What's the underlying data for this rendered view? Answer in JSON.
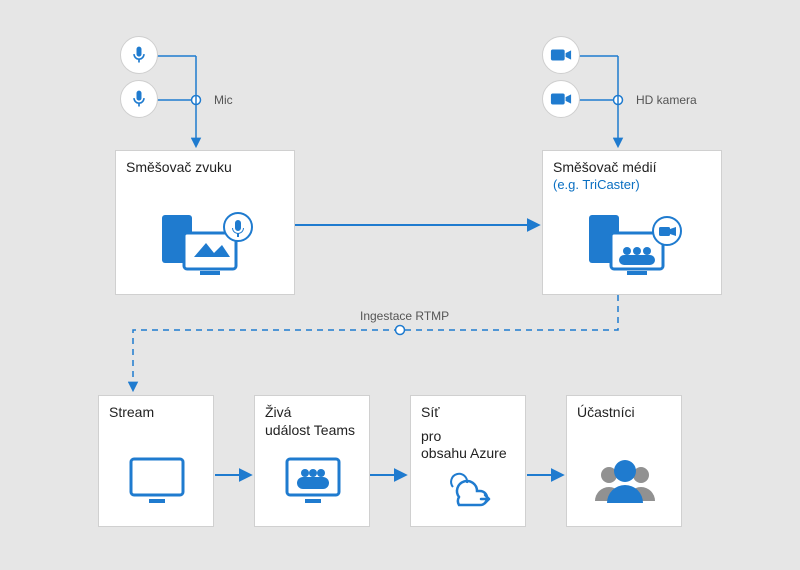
{
  "diagram": {
    "nodes": {
      "mic_label": "Mic",
      "camera_label": "HD kamera",
      "audio_mixer": {
        "title": "Směšovač zvuku"
      },
      "media_mixer": {
        "title": "Směšovač médií",
        "subtitle": "(e.g. TriCaster)"
      },
      "rtmp_label": "Ingestace RTMP",
      "stream": {
        "title": "Stream"
      },
      "teams_live": {
        "title_line1": "Živá",
        "title_line2": "událost Teams"
      },
      "azure_cdn": {
        "title_line1": "Síť",
        "title_line2": "pro",
        "title_line3": "obsahu Azure"
      },
      "attendees": {
        "title": "Účastníci"
      }
    },
    "colors": {
      "line": "#1f7bcf",
      "box_border": "#d0d0d0"
    }
  }
}
